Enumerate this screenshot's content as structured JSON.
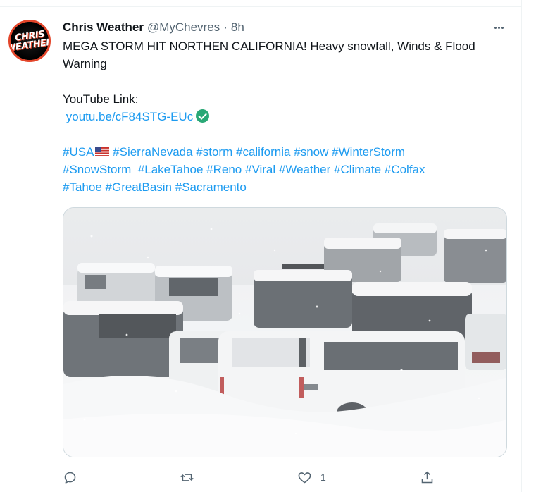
{
  "tweet": {
    "display_name": "Chris Weather",
    "handle": "@MyChevres",
    "separator": "·",
    "time": "8h",
    "avatar_text": [
      "CHRIS",
      "WEATHER"
    ],
    "text_line1": "MEGA STORM HIT NORTHEN CALIFORNIA! Heavy snowfall, Winds & Flood",
    "text_line2": "Warning",
    "youtube_label": "YouTube Link:",
    "link": "youtu.be/cF84STG-EUc",
    "hashtags_line1": [
      "#USA",
      "#SierraNevada",
      "#storm",
      "#california",
      "#snow",
      "#WinterStorm"
    ],
    "hashtags_line2": [
      "#SnowStorm",
      "#LakeTahoe",
      "#Reno",
      "#Viral",
      "#Weather",
      "#Climate",
      "#Colfax"
    ],
    "hashtags_line3": [
      "#Tahoe",
      "#GreatBasin",
      "#Sacramento"
    ],
    "image_icon": "snow-buried-cars-photo"
  },
  "actions": {
    "reply_icon": "reply-icon",
    "retweet_icon": "retweet-icon",
    "like_icon": "heart-icon",
    "like_count": "1",
    "share_icon": "share-icon"
  },
  "colors": {
    "link": "#1d9bf0",
    "text": "#0f1419",
    "muted": "#536471",
    "verified_badge": "#2aa876",
    "avatar_ring": "#e3452a"
  }
}
